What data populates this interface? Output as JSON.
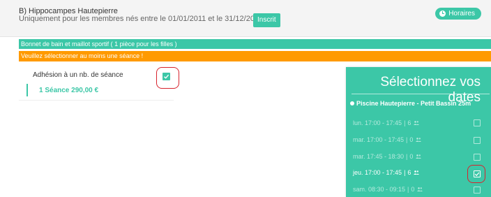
{
  "header": {
    "title": "B) Hippocampes Hautepierre",
    "subtitle": "Uniquement pour les membres nés entre le 01/01/2011 et le 31/12/2015",
    "inscrit_label": "Inscrit",
    "horaires_label": "Horaires"
  },
  "notices": {
    "equipment": "Bonnet de bain et maillot sportif ( 1 pièce pour les filles )",
    "warning": "Veuillez sélectionner au moins une séance !"
  },
  "membership": {
    "label": "Adhésion à un nb. de séance",
    "checked": true,
    "option": "1 Séance 290,00 €"
  },
  "dates_panel": {
    "title": "Sélectionnez vos dates",
    "location": "Piscine Hautepierre - Petit Bassin 25m",
    "slots": [
      {
        "time": "lun. 17:00 - 17:45",
        "count": "6",
        "checked": false
      },
      {
        "time": "mar. 17:00 - 17:45",
        "count": "0",
        "checked": false
      },
      {
        "time": "mar. 17:45 - 18:30",
        "count": "0",
        "checked": false
      },
      {
        "time": "jeu. 17:00 - 17:45",
        "count": "6",
        "checked": true
      },
      {
        "time": "sam. 08:30 - 09:15",
        "count": "0",
        "checked": false
      }
    ]
  },
  "colors": {
    "accent": "#3cc7a7",
    "warning": "#ff9a00",
    "annotation": "#d7232d"
  }
}
